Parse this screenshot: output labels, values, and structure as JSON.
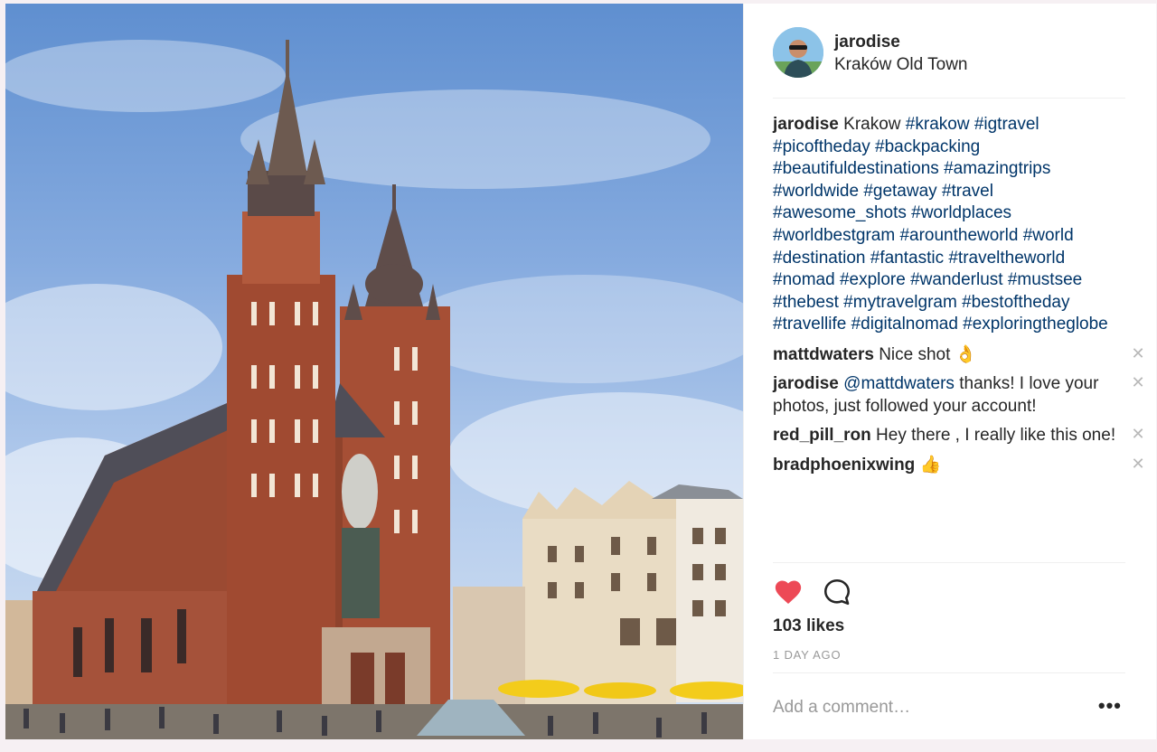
{
  "post": {
    "username": "jarodise",
    "location": "Kraków Old Town",
    "caption_user": "jarodise",
    "caption_text": "Krakow",
    "caption_tags": "#krakow #igtravel #picoftheday #backpacking #beautifuldestinations #amazingtrips #worldwide #getaway #travel #awesome_shots #worldplaces #worldbestgram #arountheworld #world #destination #fantastic #traveltheworld #nomad #explore #wanderlust #mustsee #thebest #mytravelgram #bestoftheday #travellife #digitalnomad #exploringtheglobe"
  },
  "comments": [
    {
      "user": "mattdwaters",
      "text": "Nice shot 👌",
      "mention": "",
      "rest": ""
    },
    {
      "user": "jarodise",
      "text": "",
      "mention": "@mattdwaters",
      "rest": "thanks!  I love your photos, just followed your account!"
    },
    {
      "user": "red_pill_ron",
      "text": "Hey there , I really like this one!",
      "mention": "",
      "rest": ""
    },
    {
      "user": "bradphoenixwing",
      "text": "👍",
      "mention": "",
      "rest": ""
    }
  ],
  "icons": {
    "like": "heart-icon",
    "comment": "speech-bubble-icon",
    "delete": "close-icon",
    "more": "more-options-icon",
    "delete_glyph": "✕",
    "more_glyph": "•••"
  },
  "colors": {
    "heart": "#ed4956",
    "tag_link": "#003569",
    "muted": "#999999"
  },
  "stats": {
    "likes": "103 likes",
    "time": "1 DAY AGO"
  },
  "add_comment": {
    "placeholder": "Add a comment…"
  }
}
